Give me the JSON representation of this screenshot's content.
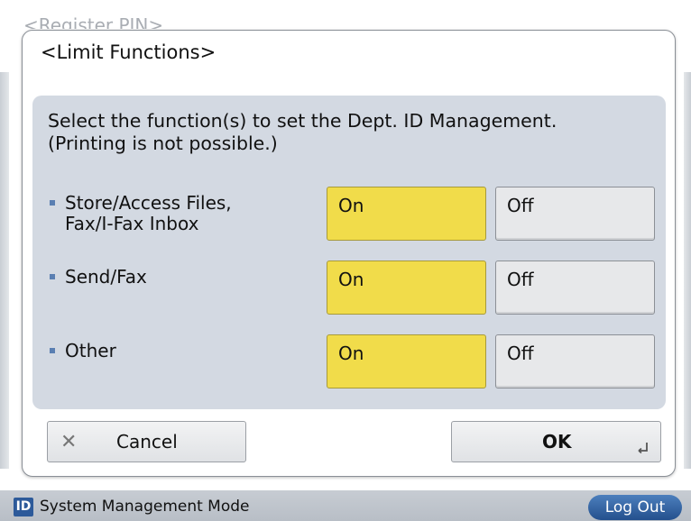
{
  "background": {
    "title": "<Register PIN>"
  },
  "dialog": {
    "title": "<Limit Functions>",
    "instruction_line1": "Select the function(s) to set the Dept. ID Management.",
    "instruction_line2": "(Printing is not possible.)",
    "rows": [
      {
        "label_line1": "Store/Access Files,",
        "label_line2": "Fax/I-Fax Inbox",
        "on_label": "On",
        "off_label": "Off",
        "selected": "On"
      },
      {
        "label_line1": "Send/Fax",
        "label_line2": "",
        "on_label": "On",
        "off_label": "Off",
        "selected": "On"
      },
      {
        "label_line1": "Other",
        "label_line2": "",
        "on_label": "On",
        "off_label": "Off",
        "selected": "On"
      }
    ],
    "cancel_label": "Cancel",
    "ok_label": "OK"
  },
  "status_bar": {
    "id_icon_text": "ID",
    "mode_label": "System Management Mode",
    "logout_label": "Log Out"
  },
  "colors": {
    "selected_toggle": "#f1dc4a",
    "panel": "#d3d9e2",
    "logout_button": "#2d5a9a"
  }
}
